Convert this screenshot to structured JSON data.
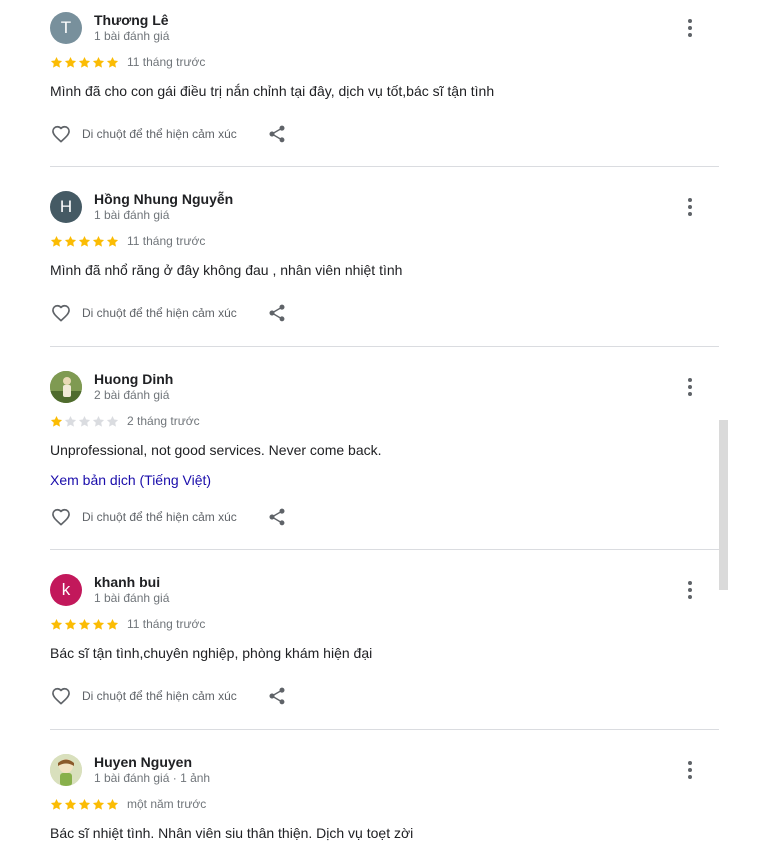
{
  "labels": {
    "react_prompt": "Di chuột để thể hiện cảm xúc",
    "translate_link": "Xem bản dịch (Tiếng Việt)"
  },
  "colors": {
    "star_filled": "#fbbc04",
    "star_empty": "#dadce0",
    "link": "#1a0dab",
    "divider": "#dadce0"
  },
  "icons": {
    "more": "more-vertical-icon",
    "like": "heart-outline-icon",
    "share": "share-icon",
    "star": "star-icon"
  },
  "reviews": [
    {
      "author": "Thương Lê",
      "avatar_letter": "T",
      "avatar_color": "#78909c",
      "meta": "1 bài đánh giá",
      "rating": 5,
      "age": "11 tháng trước",
      "text": "Mình đã cho con gái điều trị nắn chỉnh tại đây, dịch vụ tốt,bác sĩ tận tình"
    },
    {
      "author": "Hồng Nhung Nguyễn",
      "avatar_letter": "H",
      "avatar_color": "#455a64",
      "meta": "1 bài đánh giá",
      "rating": 5,
      "age": "11 tháng trước",
      "text": "Mình đã nhổ răng ở đây không đau , nhân viên nhiệt tình"
    },
    {
      "author": "Huong Dinh",
      "avatar_letter": "",
      "avatar_color": "#6e8a45",
      "meta": "2 bài đánh giá",
      "rating": 1,
      "age": "2 tháng trước",
      "text": "Unprofessional, not good services. Never come back."
    },
    {
      "author": "khanh bui",
      "avatar_letter": "k",
      "avatar_color": "#c2185b",
      "meta": "1 bài đánh giá",
      "rating": 5,
      "age": "11 tháng trước",
      "text": "Bác sĩ tận tình,chuyên nghiệp, phòng khám hiện đại"
    },
    {
      "author": "Huyen Nguyen",
      "avatar_letter": "",
      "avatar_color": "#cfd8b0",
      "meta": "1 bài đánh giá · 1 ảnh",
      "rating": 5,
      "age": "một năm trước",
      "text": "Bác sĩ nhiệt tình. Nhân viên siu thân thiện. Dịch vụ toẹt zời"
    }
  ]
}
